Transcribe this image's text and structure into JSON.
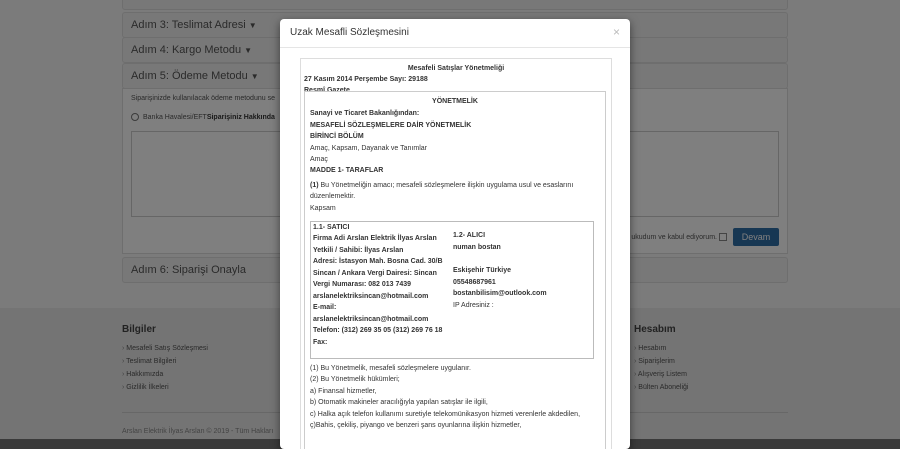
{
  "steps": {
    "step3": "Adım 3: Teslimat Adresi",
    "step4": "Adım 4: Kargo Metodu",
    "step5": "Adım 5: Ödeme Metodu",
    "step6": "Adım 6: Siparişi Onayla"
  },
  "payment": {
    "desc": "Siparişinizde kullanılacak ödeme metodunu se",
    "option": "Banka Havalesi/EFT",
    "option_bold": "Siparişiniz Hakkında",
    "agree": "ukudum ve kabul ediyorum.",
    "continue_label": "Devam"
  },
  "footer": {
    "col1_title": "Bilgiler",
    "col1_items": [
      "Mesafeli Satış Sözleşmesi",
      "Teslimat Bilgileri",
      "Hakkımızda",
      "Gizlilik İlkeleri"
    ],
    "col2_title": "Hesabım",
    "col2_items": [
      "Hesabım",
      "Siparişlerim",
      "Alışveriş Listem",
      "Bülten Aboneliği"
    ],
    "copyright": "Arslan Elektrik İlyas Arslan © 2019 - Tüm Hakları"
  },
  "modal": {
    "title": "Uzak Mesafli Sözleşmesini",
    "close": "×"
  },
  "doc": {
    "l01": "Mesafeli Satışlar Yönetmeliği",
    "l02": "27 Kasım 2014 Perşembe Sayı: 29188",
    "l03": "Resmî Gazete",
    "l04": "YÖNETMELİK",
    "l05": "Sanayi ve Ticaret Bakanlığından:",
    "l06": "MESAFELİ SÖZLEŞMELERE DAİR YÖNETMELİK",
    "l07": "BİRİNCİ BÖLÜM",
    "l08": "Amaç, Kapsam, Dayanak ve Tanımlar",
    "l09": "Amaç",
    "l10": "MADDE 1- TARAFLAR",
    "l11a": "(1)",
    "l11b": " Bu Yönetmeliğin amacı; mesafeli sözleşmelere ilişkin uygulama usul ve esaslarını",
    "l12": "düzenlemektir.",
    "l13": "Kapsam",
    "seller": [
      "1.1- SATICI",
      "Firma Adi Arslan Elektrik İlyas Arslan",
      "Yetkili / Sahibi: İlyas Arslan",
      "Adresi: İstasyon Mah. Bosna Cad. 30/B",
      "Sincan / Ankara Vergi Dairesi: Sincan",
      "Vergi Numarası: 082 013 7439",
      "arslanelektriksincan@hotmail.com",
      "E-mail:",
      "arslanelektriksincan@hotmail.com",
      "Telefon: (312) 269 35 05 (312) 269 76 18",
      "Fax:"
    ],
    "buyer_title": "1.2- ALICI",
    "buyer_name": "numan bostan",
    "buyer_city": "Eskişehir Türkiye",
    "buyer_phone": "05548687961",
    "buyer_email": "bostanbilisim@outlook.com",
    "buyer_ip": "IP Adresiniz :",
    "l20": "(1) Bu Yönetmelik, mesafeli sözleşmelere uygulanır.",
    "l21": "(2) Bu Yönetmelik hükümleri;",
    "l22": "a) Finansal hizmetler,",
    "l23": "b) Otomatik makineler aracılığıyla yapılan satışlar ile ilgili,",
    "l24": "c) Halka açık telefon kullanımı suretiyle telekomünikasyon hizmeti verenlerle akdedilen,",
    "l25": "ç)Bahis, çekiliş, piyango ve benzeri şans oyunlarına ilişkin hizmetler,"
  }
}
